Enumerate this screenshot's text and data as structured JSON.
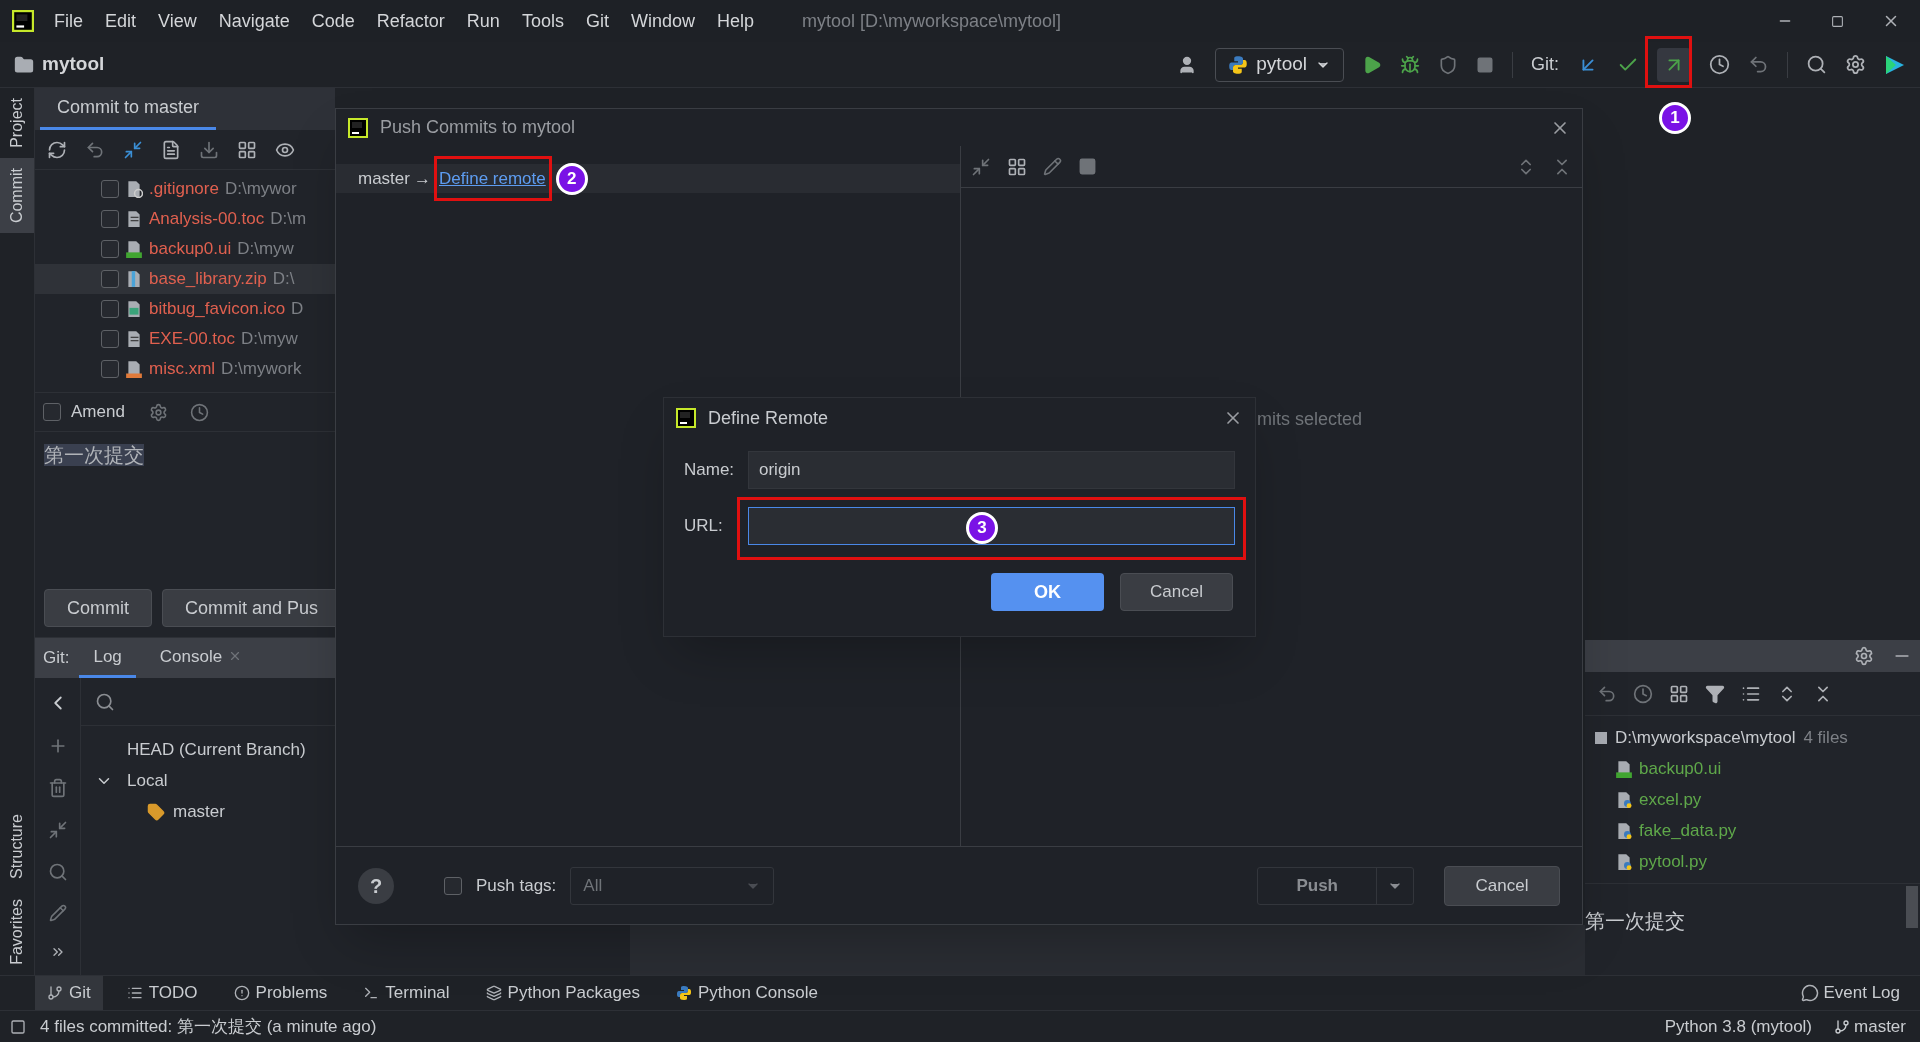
{
  "menu": {
    "items": [
      "File",
      "Edit",
      "View",
      "Navigate",
      "Code",
      "Refactor",
      "Run",
      "Tools",
      "Git",
      "Window",
      "Help"
    ],
    "title": "mytool [D:\\myworkspace\\mytool]"
  },
  "navbar": {
    "project": "mytool",
    "run_config": "pytool",
    "git_label": "Git:"
  },
  "left_stripe": [
    {
      "label": "Project",
      "selected": false
    },
    {
      "label": "Commit",
      "selected": true
    }
  ],
  "left_stripe_bottom": [
    {
      "label": "Structure"
    },
    {
      "label": "Favorites"
    }
  ],
  "commit_panel": {
    "tab": "Commit to master",
    "files": [
      {
        "name": ".gitignore",
        "path": "D:\\mywor",
        "kind": "ignore",
        "checked": false,
        "selected": false
      },
      {
        "name": "Analysis-00.toc",
        "path": "D:\\m",
        "kind": "text",
        "checked": false,
        "selected": false
      },
      {
        "name": "backup0.ui",
        "path": "D:\\myw",
        "kind": "qt",
        "checked": false,
        "selected": false
      },
      {
        "name": "base_library.zip",
        "path": "D:\\",
        "kind": "zip",
        "checked": false,
        "selected": true
      },
      {
        "name": "bitbug_favicon.ico",
        "path": "D",
        "kind": "image",
        "checked": false,
        "selected": false
      },
      {
        "name": "EXE-00.toc",
        "path": "D:\\myw",
        "kind": "text",
        "checked": false,
        "selected": false
      },
      {
        "name": "misc.xml",
        "path": "D:\\mywork",
        "kind": "xml",
        "checked": false,
        "selected": false
      }
    ],
    "amend": {
      "label": "Amend",
      "checked": false
    },
    "message": "第一次提交",
    "buttons": [
      "Commit",
      "Commit and Pus"
    ]
  },
  "git_panel": {
    "label": "Git:",
    "tabs": [
      {
        "label": "Log",
        "selected": true,
        "closable": false
      },
      {
        "label": "Console",
        "selected": false,
        "closable": true
      }
    ],
    "branches": [
      {
        "label": "HEAD (Current Branch)"
      },
      {
        "label": "Local",
        "expanded": true,
        "children": [
          {
            "label": "master"
          }
        ]
      }
    ]
  },
  "push_dialog": {
    "title": "Push Commits to mytool",
    "branch": "master",
    "arrow": "→",
    "link": "Define remote",
    "empty_text": "mits selected",
    "help": "?",
    "push_tags": {
      "label": "Push tags:",
      "checked": false,
      "value": "All"
    },
    "push": "Push",
    "cancel": "Cancel"
  },
  "define_remote": {
    "title": "Define Remote",
    "name_label": "Name:",
    "name_value": "origin",
    "url_label": "URL:",
    "ok": "OK",
    "cancel": "Cancel"
  },
  "annotations": [
    {
      "number": "1"
    },
    {
      "number": "2"
    },
    {
      "number": "3"
    }
  ],
  "changes_panel": {
    "root": "D:\\myworkspace\\mytool",
    "count": "4 files",
    "files": [
      {
        "name": "backup0.ui",
        "kind": "qt"
      },
      {
        "name": "excel.py",
        "kind": "python"
      },
      {
        "name": "fake_data.py",
        "kind": "python"
      },
      {
        "name": "pytool.py",
        "kind": "python"
      }
    ],
    "message": "第一次提交"
  },
  "bottom_tools": [
    {
      "label": "Git",
      "kind": "git",
      "selected": true
    },
    {
      "label": "TODO",
      "kind": "todo",
      "selected": false
    },
    {
      "label": "Problems",
      "kind": "problems",
      "selected": false
    },
    {
      "label": "Terminal",
      "kind": "terminal",
      "selected": false
    },
    {
      "label": "Python Packages",
      "kind": "packages",
      "selected": false
    },
    {
      "label": "Python Console",
      "kind": "console",
      "selected": false
    }
  ],
  "event_log": "Event Log",
  "status": {
    "message": "4 files committed: 第一次提交 (a minute ago)",
    "interpreter": "Python 3.8 (mytool)",
    "branch": "master"
  }
}
